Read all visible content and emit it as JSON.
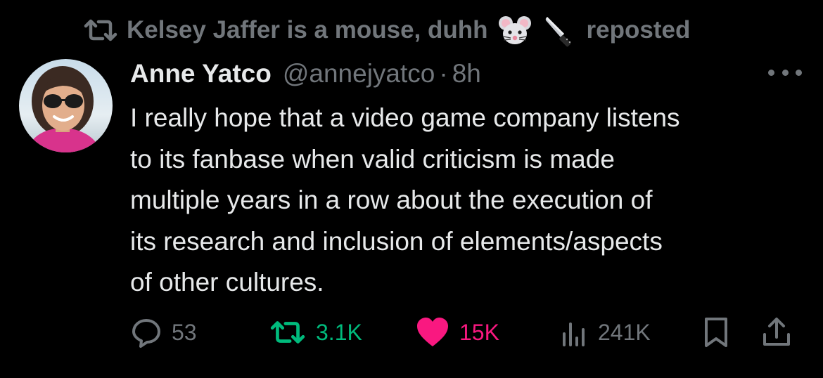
{
  "repost": {
    "reposter_name": "Kelsey Jaffer is a mouse, duhh",
    "emojis": [
      "mouse-face-emoji",
      "kitchen-knife-emoji"
    ],
    "suffix": "reposted"
  },
  "post": {
    "display_name": "Anne Yatco",
    "handle": "@annejyatco",
    "separator": "·",
    "time": "8h",
    "text_lines": [
      "I really hope that a video game company listens",
      "to its fanbase when valid criticism is made",
      "multiple years in a row about the execution of",
      "its research and inclusion of elements/aspects",
      "of other cultures."
    ]
  },
  "actions": {
    "replies": "53",
    "reposts": "3.1K",
    "likes": "15K",
    "views": "241K"
  },
  "icons": {
    "repost_header": "repost-icon",
    "more": "more-options-icon",
    "reply": "reply-icon",
    "repost": "repost-icon",
    "like": "heart-icon",
    "views": "views-bar-chart-icon",
    "bookmark": "bookmark-icon",
    "share": "share-icon"
  },
  "colors": {
    "background": "#000000",
    "primary_text": "#e7e9ea",
    "secondary_text": "#71767b",
    "repost_green": "#00ba7c",
    "like_pink": "#f91880"
  }
}
